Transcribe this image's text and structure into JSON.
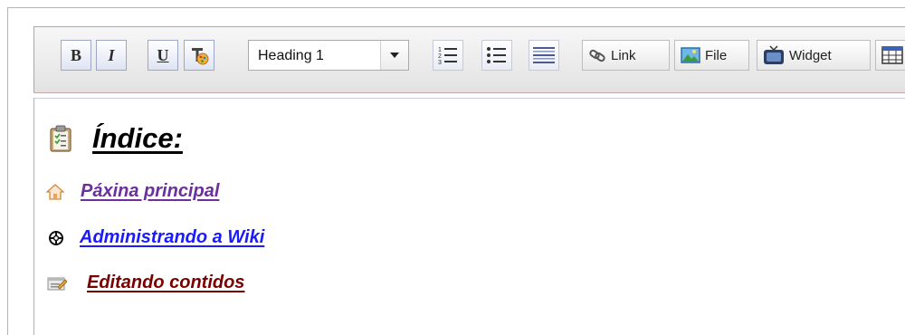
{
  "toolbar": {
    "bold_label": "B",
    "italic_label": "I",
    "underline_label": "U",
    "format_select": {
      "selected": "Heading 1"
    },
    "link_label": "Link",
    "file_label": "File",
    "widget_label": "Widget"
  },
  "content": {
    "heading": "Índice:",
    "links": [
      {
        "label": "Páxina principal",
        "color": "#6b2f9e",
        "icon": "home-icon"
      },
      {
        "label": "Administrando a Wiki",
        "color": "#1a1aff",
        "icon": "crosshair-icon"
      },
      {
        "label": "Editando contidos",
        "color": "#7a0000",
        "icon": "edit-note-icon"
      }
    ]
  },
  "colors": {
    "toolbar_border": "#a9a9a9",
    "button_active_border": "#9ea6c8"
  }
}
